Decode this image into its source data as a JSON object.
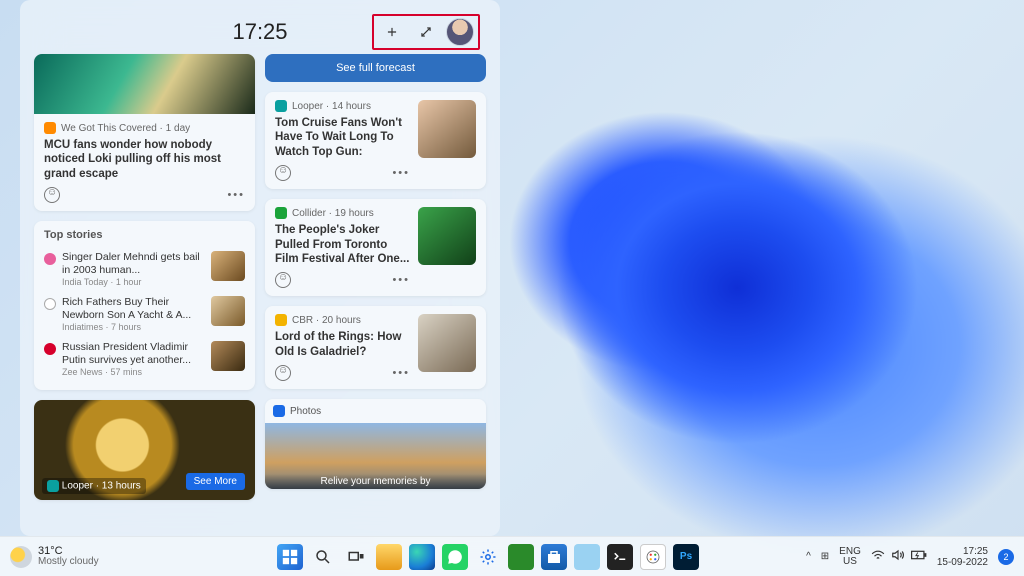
{
  "header": {
    "time": "17:25"
  },
  "left_col": {
    "hero": {
      "source_label": "We Got This Covered · 1 day",
      "title": "MCU fans wonder how nobody noticed Loki pulling off his most grand escape"
    },
    "topstories_title": "Top stories",
    "topstories": [
      {
        "title": "Singer Daler Mehndi gets bail in 2003 human...",
        "source": "India Today · 1 hour"
      },
      {
        "title": "Rich Fathers Buy Their Newborn Son A Yacht & A...",
        "source": "Indiatimes · 7 hours"
      },
      {
        "title": "Russian President Vladimir Putin survives yet another...",
        "source": "Zee News · 57 mins"
      }
    ],
    "hero2_source": "Looper · 13 hours",
    "seemore_label": "See More"
  },
  "right_col": {
    "forecast_label": "See full forecast",
    "cards": [
      {
        "source": "Looper · 14 hours",
        "title": "Tom Cruise Fans Won't Have To Wait Long To Watch Top Gun:"
      },
      {
        "source": "Collider · 19 hours",
        "title": "The People's Joker Pulled From Toronto Film Festival After One..."
      },
      {
        "source": "CBR · 20 hours",
        "title": "Lord of the Rings: How Old Is Galadriel?"
      }
    ],
    "photos_label": "Photos",
    "photos_caption": "Relive your memories by"
  },
  "taskbar": {
    "weather": {
      "temp": "31°C",
      "desc": "Mostly cloudy"
    },
    "apps": [
      {
        "name": "start"
      },
      {
        "name": "search"
      },
      {
        "name": "taskview"
      },
      {
        "name": "explorer"
      },
      {
        "name": "edge"
      },
      {
        "name": "whatsapp"
      },
      {
        "name": "settings"
      },
      {
        "name": "app-green"
      },
      {
        "name": "store"
      },
      {
        "name": "notepad"
      },
      {
        "name": "terminal"
      },
      {
        "name": "paint"
      },
      {
        "name": "photoshop",
        "label": "Ps"
      }
    ],
    "tray": {
      "chevron": "^",
      "grid": "⊞",
      "lang_top": "ENG",
      "lang_bottom": "US",
      "wifi": "�её",
      "speaker": "🔊",
      "battery": "⚡",
      "time": "17:25",
      "date": "15-09-2022",
      "notif_count": "2"
    }
  }
}
